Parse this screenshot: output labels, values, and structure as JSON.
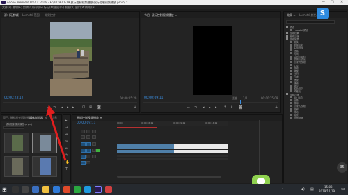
{
  "window": {
    "title": "Adobe Premiere Pro CC 2019 - E:\\2019-11-19\\鼠标控制视频播放\\鼠标控制视频播放.prproj *",
    "minimize": "—",
    "maximize": "□",
    "close": "✕"
  },
  "menu": [
    "文件(F)",
    "编辑(E)",
    "剪辑(C)",
    "序列(S)",
    "标记(M)",
    "图形(G)",
    "视图(V)",
    "窗口(W)",
    "帮助(H)"
  ],
  "source_panel": {
    "tabs": [
      "源: (无剪辑)",
      "Lumetri 范围",
      "效果控件"
    ],
    "timecode_left": "00:00:23:12",
    "timecode_right": "00:00:15:29"
  },
  "program_panel": {
    "title": "节目: 鼠标控制视频播放 ≡",
    "timecode_left": "00:00:09:11",
    "fit_label": "适合",
    "ratio": "1/2",
    "timecode_right": "00:00:15:09"
  },
  "effects_panel": {
    "tabs": [
      "效果 ≡",
      "Lumetri 颜色"
    ],
    "items": [
      "预设",
      "Lumetri 预设",
      "音频效果",
      "音频过渡",
      "视频效果",
      "变换",
      "图像控制",
      "实用程序",
      "扭曲",
      "时间",
      "杂色与颗粒",
      "模糊与锐化",
      "沉浸式视频",
      "生成",
      "视频",
      "调整",
      "过时",
      "过渡",
      "透视",
      "通道",
      "键控",
      "颜色校正",
      "风格化",
      "视频过渡",
      "3D 运动",
      "划像",
      "擦除",
      "沉浸式视频",
      "溶解",
      "滑动",
      "缩放",
      "页面剥落"
    ]
  },
  "project_panel": {
    "tabs": [
      "项目: 鼠标控制视频播放",
      "媒体浏览器",
      "库",
      "信息"
    ],
    "path": "鼠标控制视频播放.prproj"
  },
  "timeline_panel": {
    "tab": "鼠标控制视频播放 ≡",
    "timecode": "00:00:09:11",
    "ruler_labels": [
      "00:00",
      "00:00:04:29",
      "00:00:09:29",
      "00:00:14:29"
    ]
  },
  "taskbar": {
    "time": "15:03",
    "date": "2019/11/19",
    "volume_badge": "35"
  },
  "colors": {
    "accent_blue": "#3b8ddf",
    "playhead": "#3b8ddf",
    "red_arrow": "#e01e1e",
    "green_badge": "#8fd14f"
  }
}
